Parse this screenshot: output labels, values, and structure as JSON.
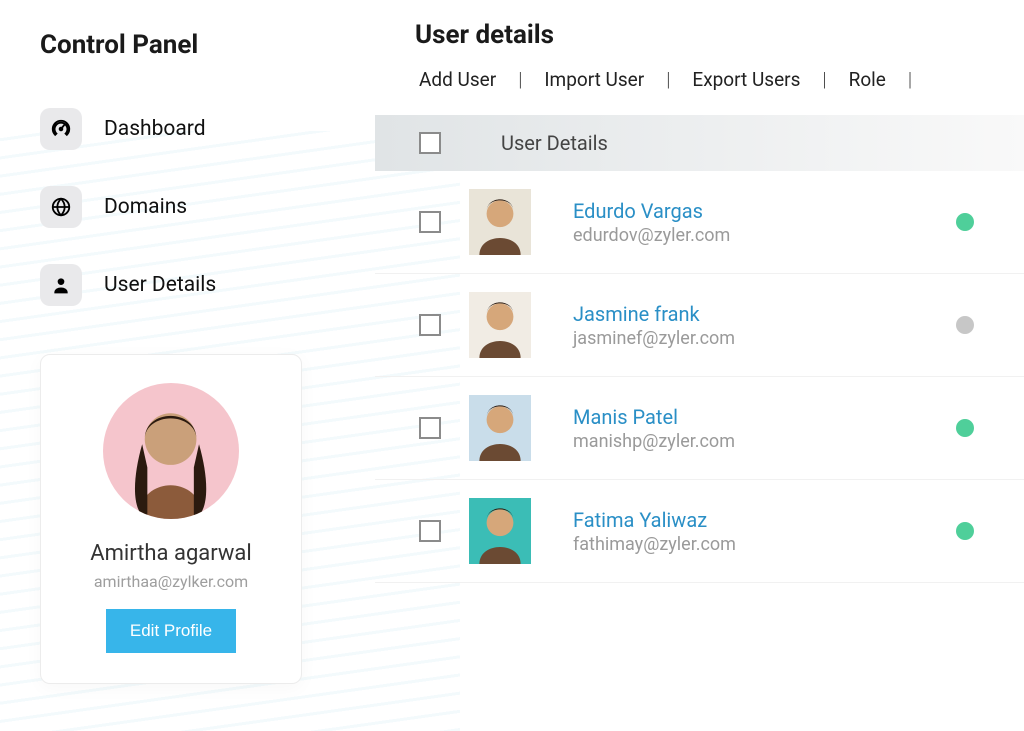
{
  "sidebar": {
    "title": "Control Panel",
    "nav": [
      {
        "label": "Dashboard",
        "icon": "gauge-icon"
      },
      {
        "label": "Domains",
        "icon": "globe-icon"
      },
      {
        "label": "User Details",
        "icon": "user-icon"
      }
    ],
    "profile": {
      "name": "Amirtha agarwal",
      "email": "amirthaa@zylker.com",
      "edit_label": "Edit Profile"
    }
  },
  "main": {
    "title": "User details",
    "actions": [
      "Add User",
      "Import User",
      "Export Users",
      "Role"
    ],
    "table": {
      "header_label": "User Details"
    },
    "users": [
      {
        "name": "Edurdo Vargas",
        "email": "edurdov@zyler.com",
        "status_color": "#4fcf9a",
        "avatar_bg": "#e9e4d8"
      },
      {
        "name": "Jasmine frank",
        "email": "jasminef@zyler.com",
        "status_color": "#c7c7c7",
        "avatar_bg": "#f1ece4"
      },
      {
        "name": "Manis Patel",
        "email": "manishp@zyler.com",
        "status_color": "#4fcf9a",
        "avatar_bg": "#c9ddea"
      },
      {
        "name": "Fatima Yaliwaz",
        "email": "fathimay@zyler.com",
        "status_color": "#4fcf9a",
        "avatar_bg": "#3bbdb6"
      }
    ]
  }
}
